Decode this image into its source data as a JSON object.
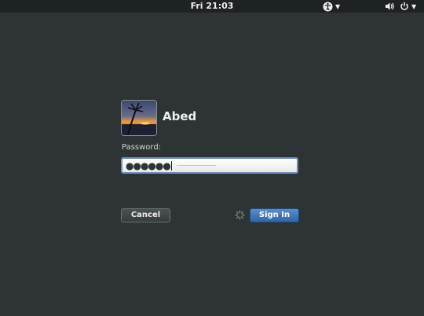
{
  "topbar": {
    "clock": "Fri 21:03",
    "icons": [
      "accessibility-icon",
      "volume-icon",
      "power-icon"
    ]
  },
  "login": {
    "username": "Abed",
    "password_label": "Password:",
    "password_value": "●●●●●●",
    "cancel_label": "Cancel",
    "signin_label": "Sign In"
  },
  "colors": {
    "background": "#2e3436",
    "topbar": "#1f2223",
    "accent": "#3b73b8",
    "text": "#eeeeec"
  }
}
